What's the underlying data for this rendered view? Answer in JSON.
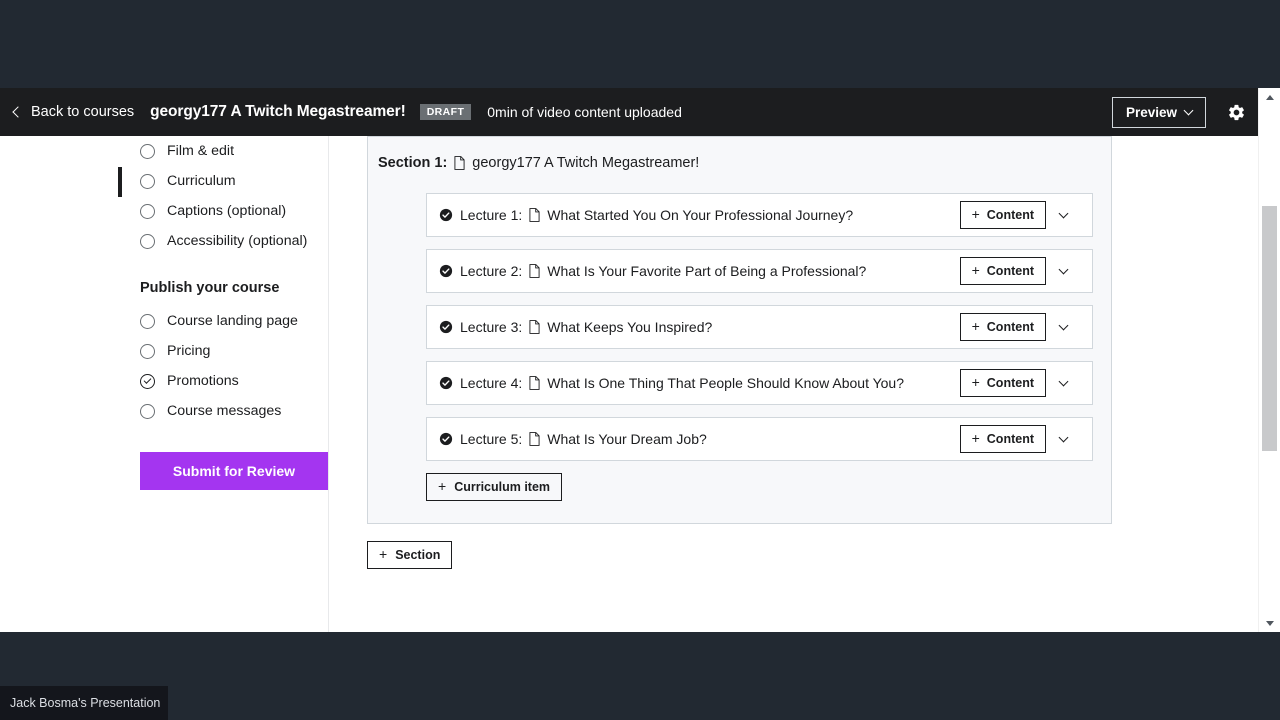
{
  "header": {
    "back_label": "Back to courses",
    "back_icon": "chevron-left-icon",
    "course_title": "georgy177 A Twitch Megastreamer!",
    "status_badge": "DRAFT",
    "upload_status": "0min of video content uploaded",
    "preview_label": "Preview",
    "preview_caret_icon": "chevron-down-icon",
    "settings_icon": "gear-icon",
    "bg_color": "#1c1d1f"
  },
  "sidebar": {
    "items": [
      {
        "label": "Film & edit",
        "checked": false,
        "active": false
      },
      {
        "label": "Curriculum",
        "checked": false,
        "active": true
      },
      {
        "label": "Captions (optional)",
        "checked": false,
        "active": false
      },
      {
        "label": "Accessibility (optional)",
        "checked": false,
        "active": false
      }
    ],
    "publish_heading": "Publish your course",
    "publish_items": [
      {
        "label": "Course landing page",
        "checked": false,
        "active": false
      },
      {
        "label": "Pricing",
        "checked": false,
        "active": false
      },
      {
        "label": "Promotions",
        "checked": true,
        "active": false
      },
      {
        "label": "Course messages",
        "checked": false,
        "active": false
      }
    ],
    "submit_label": "Submit for Review",
    "submit_color": "#a435f0"
  },
  "curriculum": {
    "section": {
      "label": "Section 1:",
      "icon": "document-icon",
      "title": "georgy177 A Twitch Megastreamer!"
    },
    "lectures": [
      {
        "label": "Lecture 1:",
        "title": "What Started You On Your Professional Journey?",
        "status_icon": "check-circle-icon",
        "doc_icon": "document-icon",
        "content_label": "Content",
        "caret_icon": "chevron-down-icon"
      },
      {
        "label": "Lecture 2:",
        "title": "What Is Your Favorite Part of Being a Professional?",
        "status_icon": "check-circle-icon",
        "doc_icon": "document-icon",
        "content_label": "Content",
        "caret_icon": "chevron-down-icon"
      },
      {
        "label": "Lecture 3:",
        "title": "What Keeps You Inspired?",
        "status_icon": "check-circle-icon",
        "doc_icon": "document-icon",
        "content_label": "Content",
        "caret_icon": "chevron-down-icon"
      },
      {
        "label": "Lecture 4:",
        "title": "What Is One Thing That People Should Know About You?",
        "status_icon": "check-circle-icon",
        "doc_icon": "document-icon",
        "content_label": "Content",
        "caret_icon": "chevron-down-icon"
      },
      {
        "label": "Lecture 5:",
        "title": "What Is Your Dream Job?",
        "status_icon": "check-circle-icon",
        "doc_icon": "document-icon",
        "content_label": "Content",
        "caret_icon": "chevron-down-icon"
      }
    ],
    "add_curriculum_item_label": "Curriculum item",
    "add_section_label": "Section",
    "plus_glyph": "+"
  },
  "scrollbar": {
    "up_icon": "scroll-up-arrow-icon",
    "down_icon": "scroll-down-arrow-icon"
  },
  "taskbar": {
    "item_label": "Jack Bosma's Presentation"
  }
}
